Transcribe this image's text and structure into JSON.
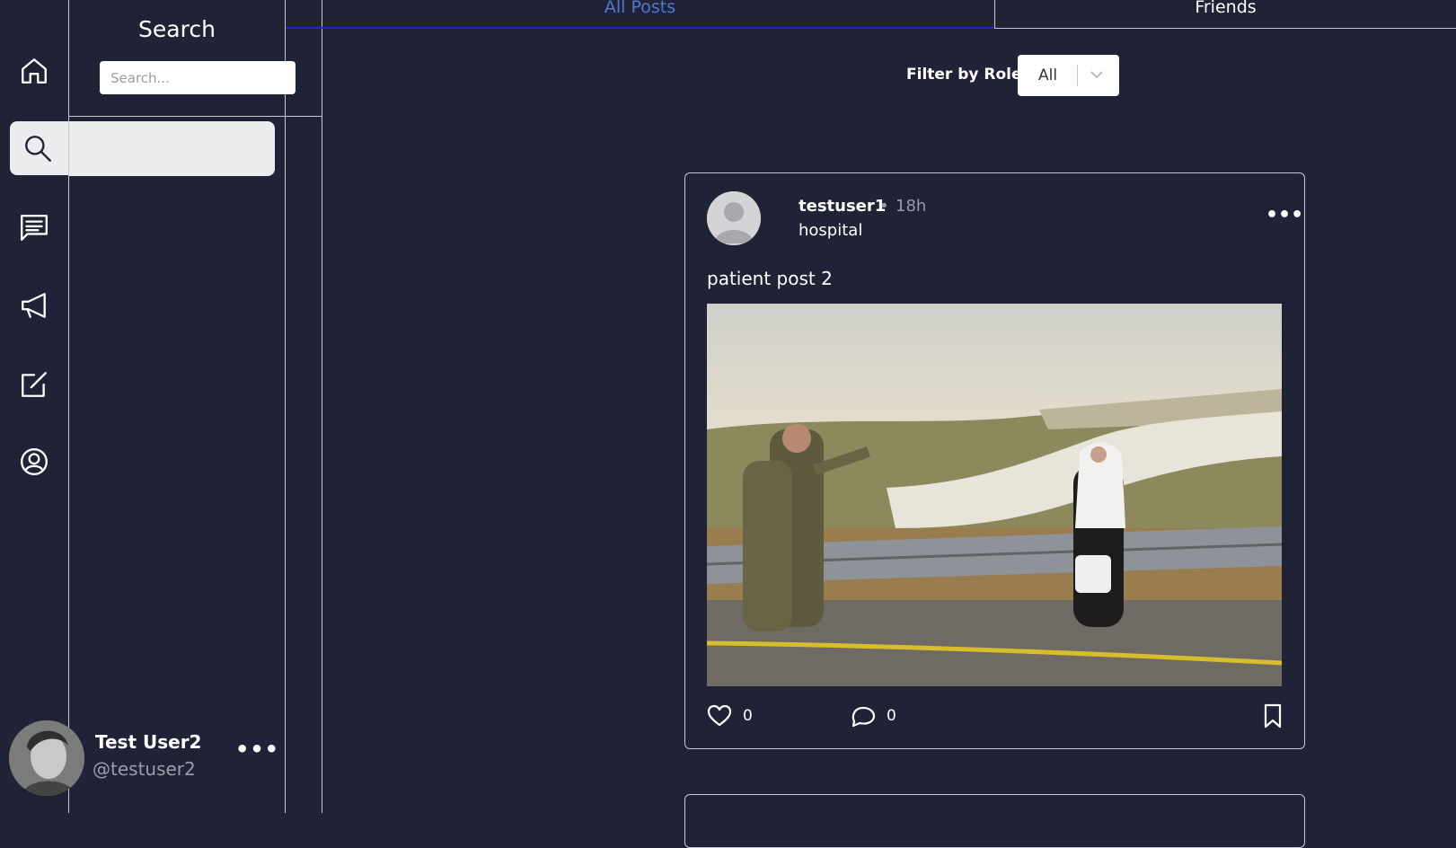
{
  "sidebar": {
    "nav": [
      {
        "icon": "home-icon",
        "active": false
      },
      {
        "icon": "search-icon",
        "active": true
      },
      {
        "icon": "messages-icon",
        "active": false
      },
      {
        "icon": "megaphone-icon",
        "active": false
      },
      {
        "icon": "compose-icon",
        "active": false
      },
      {
        "icon": "profile-icon",
        "active": false
      }
    ]
  },
  "search_panel": {
    "title": "Search",
    "placeholder": "Search..."
  },
  "current_user": {
    "name": "Test User2",
    "handle": "@testuser2",
    "more": "•••"
  },
  "tabs": [
    {
      "label": "All Posts",
      "active": true
    },
    {
      "label": "Friends",
      "active": false
    }
  ],
  "filter": {
    "label": "Filter by Role:",
    "value": "All"
  },
  "posts": [
    {
      "username": "testuser1",
      "separator": "•",
      "time": "18h",
      "role": "hospital",
      "more": "•••",
      "text": "patient post 2",
      "image": "photo-soldiers-and-woman-by-road",
      "likes": "0",
      "comments": "0"
    }
  ],
  "colors": {
    "background": "#202336",
    "active_tab": "#4f79d0",
    "tab_underline": "#1d24d1",
    "border": "#c7c9d1"
  }
}
